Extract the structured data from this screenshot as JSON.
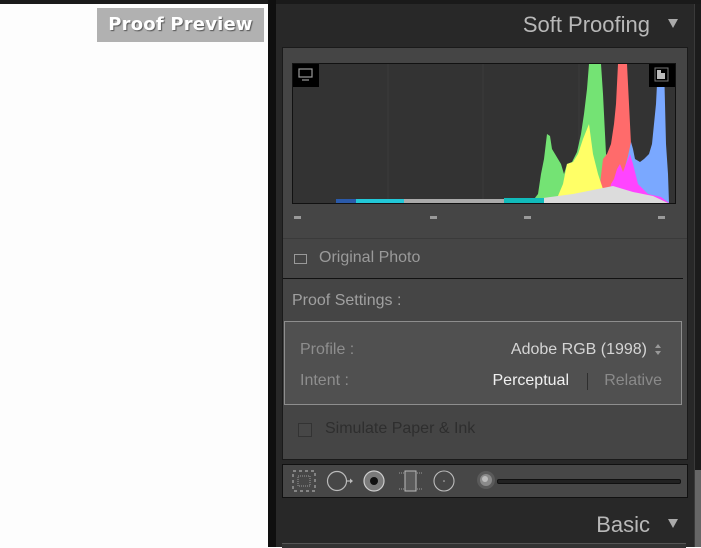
{
  "preview": {
    "badge_label": "Proof Preview"
  },
  "soft_proofing": {
    "title": "Soft Proofing",
    "collapse_icon": "triangle-down-icon",
    "histogram": {
      "left_icon": "monitor-gamut-warning-icon",
      "right_icon": "destination-gamut-warning-icon"
    },
    "original_photo_label": "Original Photo",
    "proof_settings_label": "Proof Settings :",
    "profile_label": "Profile :",
    "profile_value": "Adobe RGB (1998)",
    "intent_label": "Intent :",
    "intent_options": [
      "Perceptual",
      "Relative"
    ],
    "intent_selected": "Perceptual",
    "simulate_label": "Simulate Paper & Ink",
    "simulate_checked": false
  },
  "toolbar": {
    "tools": [
      {
        "name": "crop-overlay-tool",
        "icon": "crop-grid-icon"
      },
      {
        "name": "spot-removal-tool",
        "icon": "circle-arrow-icon"
      },
      {
        "name": "red-eye-tool",
        "icon": "eye-icon"
      },
      {
        "name": "graduated-filter-tool",
        "icon": "rectangle-filter-icon"
      },
      {
        "name": "radial-filter-tool",
        "icon": "radial-circle-icon"
      },
      {
        "name": "adjustment-brush-tool",
        "icon": "brush-icon"
      }
    ]
  },
  "basic": {
    "title": "Basic",
    "collapse_icon": "triangle-down-icon"
  },
  "colors": {
    "panel_bg": "#282828",
    "section_bg": "#454545",
    "histogram_red": "#ff6b6b",
    "histogram_green": "#74e374",
    "histogram_blue": "#7aa8ff",
    "histogram_yellow": "#ffff66",
    "histogram_magenta": "#ff44ff",
    "histogram_cyan": "#22c8d8"
  }
}
